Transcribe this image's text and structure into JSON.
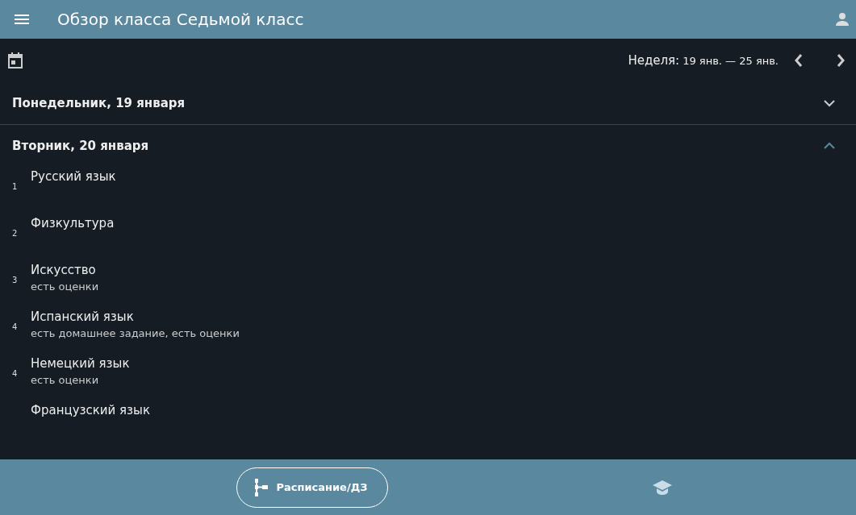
{
  "app_bar": {
    "title": "Обзор класса Седьмой класс"
  },
  "week": {
    "label": "Неделя:",
    "range": "19 янв. — 25 янв."
  },
  "days": [
    {
      "title": "Понедельник, 19 января",
      "expanded": false
    },
    {
      "title": "Вторник, 20 января",
      "expanded": true,
      "lessons": [
        {
          "number": "1",
          "name": "Русский язык"
        },
        {
          "number": "2",
          "name": "Физкультура"
        },
        {
          "number": "3",
          "name": "Искусство",
          "note": "есть оценки"
        },
        {
          "number": "4",
          "name": "Испанский язык",
          "note": "есть домашнее задание, есть оценки"
        },
        {
          "number": "4",
          "name": "Немецкий язык",
          "note": "есть оценки"
        },
        {
          "name": "Французский язык"
        }
      ]
    }
  ],
  "bottom_nav": [
    {
      "label": "Расписание/ДЗ",
      "selected": true
    },
    {
      "selected": false
    }
  ]
}
